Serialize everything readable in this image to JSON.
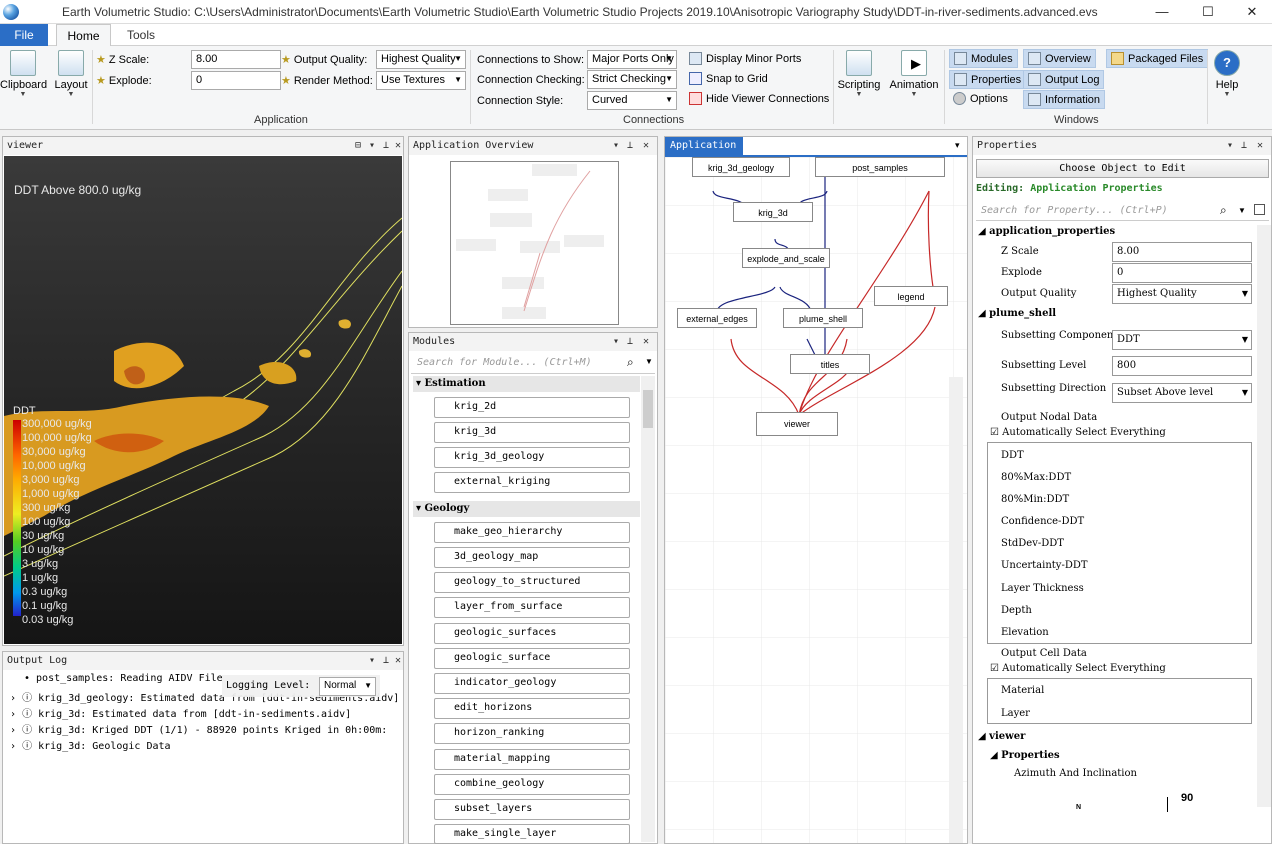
{
  "window": {
    "title": "Earth Volumetric Studio: C:\\Users\\Administrator\\Documents\\Earth Volumetric Studio\\Earth Volumetric Studio Projects 2019.10\\Anisotropic Variography Study\\DDT-in-river-sediments.advanced.evs",
    "minimize": "—",
    "maximize": "☐",
    "close": "✕"
  },
  "ribbon_tabs": {
    "file": "File",
    "home": "Home",
    "tools": "Tools"
  },
  "ribbon": {
    "clipboard": "Clipboard",
    "layout": "Layout",
    "z_scale_label": "Z Scale:",
    "z_scale_value": "8.00",
    "explode_label": "Explode:",
    "explode_value": "0",
    "output_quality_label": "Output Quality:",
    "output_quality_value": "Highest Quality",
    "render_method_label": "Render Method:",
    "render_method_value": "Use Textures",
    "application_group": "Application",
    "conn_show_label": "Connections to Show:",
    "conn_show_value": "Major Ports Only",
    "conn_check_label": "Connection Checking:",
    "conn_check_value": "Strict Checking",
    "conn_style_label": "Connection Style:",
    "conn_style_value": "Curved",
    "display_minor_ports": "Display Minor Ports",
    "snap_to_grid": "Snap to Grid",
    "hide_viewer_connections": "Hide Viewer Connections",
    "connections_group": "Connections",
    "scripting": "Scripting",
    "animation": "Animation",
    "modules": "Modules",
    "overview": "Overview",
    "packaged_files": "Packaged Files",
    "properties": "Properties",
    "output_log": "Output Log",
    "options": "Options",
    "information": "Information",
    "windows_group": "Windows",
    "help": "Help"
  },
  "viewer": {
    "title": "viewer",
    "heading": "DDT Above 800.0 ug/kg",
    "legend_title": "DDT",
    "legend": [
      "300,000 ug/kg",
      "100,000 ug/kg",
      "30,000 ug/kg",
      "10,000 ug/kg",
      "3,000 ug/kg",
      "1,000 ug/kg",
      "300 ug/kg",
      "100 ug/kg",
      "30 ug/kg",
      "10 ug/kg",
      "3 ug/kg",
      "1 ug/kg",
      "0.3 ug/kg",
      "0.1 ug/kg",
      "0.03 ug/kg"
    ]
  },
  "output_log": {
    "title": "Output Log",
    "logging_label": "Logging Level:",
    "logging_value": "Normal",
    "lines": [
      "• post_samples: Reading AIDV File",
      "krig_3d_geology: Estimated data from [ddt-in-sediments.aidv]",
      "krig_3d: Estimated data from [ddt-in-sediments.aidv]",
      "krig_3d: Kriged DDT (1/1) - 88920 points Kriged in 0h:00m:",
      "krig_3d: Geologic Data"
    ]
  },
  "overview": {
    "title": "Application Overview"
  },
  "modules": {
    "title": "Modules",
    "search_placeholder": "Search for Module...   (Ctrl+M)",
    "cat_estimation": "Estimation",
    "cat_geology": "Geology",
    "estimation": [
      "krig_2d",
      "krig_3d",
      "krig_3d_geology",
      "external_kriging"
    ],
    "geology": [
      "make_geo_hierarchy",
      "3d_geology_map",
      "geology_to_structured",
      "layer_from_surface",
      "geologic_surfaces",
      "geologic_surface",
      "indicator_geology",
      "edit_horizons",
      "horizon_ranking",
      "material_mapping",
      "combine_geology",
      "subset_layers",
      "make_single_layer"
    ]
  },
  "application": {
    "title": "Application",
    "nodes": {
      "krig_3d_geology": "krig_3d_geology",
      "post_samples": "post_samples",
      "krig_3d": "krig_3d",
      "explode_and_scale": "explode_and_scale",
      "legend": "legend",
      "external_edges": "external_edges",
      "plume_shell": "plume_shell",
      "titles": "titles",
      "viewer": "viewer"
    }
  },
  "properties": {
    "title": "Properties",
    "choose_button": "Choose Object to Edit",
    "editing_label": "Editing:",
    "editing_value": "Application Properties",
    "search_placeholder": "Search for Property...   (Ctrl+P)",
    "sec_app": "application_properties",
    "z_scale_label": "Z Scale",
    "z_scale_value": "8.00",
    "explode_label": "Explode",
    "explode_value": "0",
    "output_quality_label": "Output Quality",
    "output_quality_value": "Highest Quality",
    "sec_plume": "plume_shell",
    "subsetting_component_label": "Subsetting Component",
    "subsetting_component_value": "DDT",
    "subsetting_level_label": "Subsetting Level",
    "subsetting_level_value": "800",
    "subsetting_direction_label": "Subsetting Direction",
    "subsetting_direction_value": "Subset Above level",
    "output_nodal_label": "Output Nodal Data",
    "auto_select_label": "Automatically Select Everything",
    "nodal_options": [
      "DDT",
      "80%Max:DDT",
      "80%Min:DDT",
      "Confidence-DDT",
      "StdDev-DDT",
      "Uncertainty-DDT",
      "Layer Thickness",
      "Depth",
      "Elevation"
    ],
    "output_cell_label": "Output Cell Data",
    "auto_select_label2": "Automatically Select Everything",
    "cell_options": [
      "Material",
      "Layer"
    ],
    "sec_viewer": "viewer",
    "sec_viewer_props": "Properties",
    "azimuth_label": "Azimuth And Inclination",
    "dial_value": "90",
    "dial_n": "N"
  }
}
